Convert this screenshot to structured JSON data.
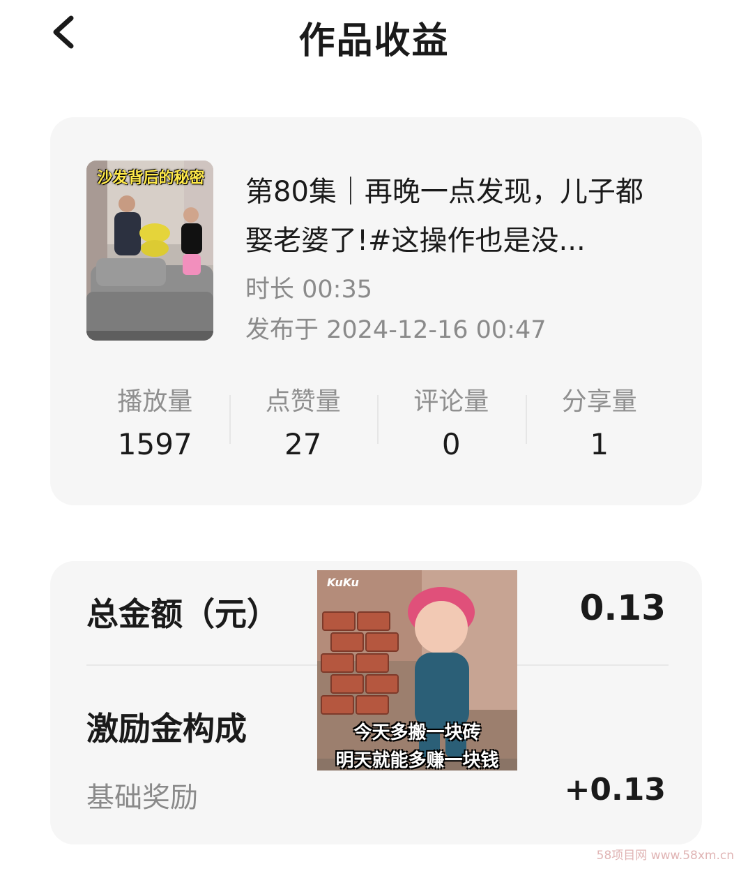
{
  "header": {
    "title": "作品收益"
  },
  "video": {
    "thumb_caption": "沙发背后的秘密",
    "title": "第80集｜再晚一点发现，儿子都娶老婆了!#这操作也是没...",
    "duration": "时长 00:35",
    "published": "发布于 2024-12-16 00:47"
  },
  "stats": [
    {
      "label": "播放量",
      "value": "1597"
    },
    {
      "label": "点赞量",
      "value": "27"
    },
    {
      "label": "评论量",
      "value": "0"
    },
    {
      "label": "分享量",
      "value": "1"
    }
  ],
  "earnings": {
    "total_label": "总金额（元）",
    "total_value": "0.13",
    "section_label": "激励金构成",
    "basic_label": "基础奖励",
    "basic_value": "+0.13"
  },
  "meme": {
    "logo": "KuKu",
    "line1": "今天多搬一块砖",
    "line2": "明天就能多赚一块钱"
  },
  "watermark": "58项目网 www.58xm.cn"
}
